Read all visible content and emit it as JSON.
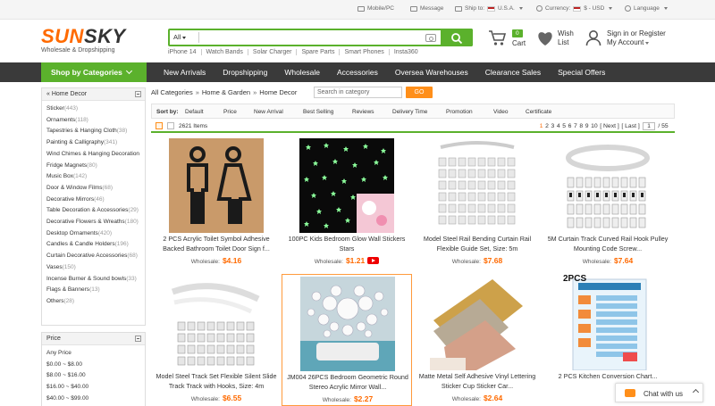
{
  "colors": {
    "brand_orange": "#ff6a00",
    "accent_green": "#5bb12c",
    "nav_dark": "#3a3a3a"
  },
  "topbar": {
    "mobile": "Mobile/PC",
    "message": "Message",
    "ship_to": "Ship to:",
    "ship_country": "U.S.A.",
    "currency": "Currency:",
    "currency_value": "$ - USD",
    "language": "Language"
  },
  "logo": {
    "brand_main": "SUN",
    "brand_tail": "SKY",
    "tagline": "Wholesale & Dropshipping"
  },
  "search": {
    "category": "All",
    "placeholder": "",
    "hotwords": [
      "iPhone 14",
      "Watch Bands",
      "Solar Charger",
      "Spare Parts",
      "Smart Phones",
      "Insta360"
    ]
  },
  "header": {
    "cart_count": "0",
    "cart_label": "Cart",
    "wish_label": "Wish List",
    "signin_label": "Sign in or Register",
    "account_label": "My Account"
  },
  "nav": {
    "shop_by": "Shop by Categories",
    "links": [
      "New Arrivals",
      "Dropshipping",
      "Wholesale",
      "Accessories",
      "Oversea Warehouses",
      "Clearance Sales",
      "Special Offers"
    ]
  },
  "sidebar": {
    "category_head": "« Home Decor",
    "categories": [
      {
        "name": "Sticker",
        "count": "(443)"
      },
      {
        "name": "Ornaments",
        "count": "(118)"
      },
      {
        "name": "Tapestries & Hanging Cloth",
        "count": "(38)"
      },
      {
        "name": "Painting & Calligraphy",
        "count": "(341)"
      },
      {
        "name": "Wind Chimes & Hanging Decoration",
        "count": ""
      },
      {
        "name": "Fridge Magnets",
        "count": "(80)"
      },
      {
        "name": "Music Box",
        "count": "(142)"
      },
      {
        "name": "Door & Window Films",
        "count": "(68)"
      },
      {
        "name": "Decorative Mirrors",
        "count": "(46)"
      },
      {
        "name": "Table Decoration & Accessories",
        "count": "(29)"
      },
      {
        "name": "Decorative Flowers & Wreaths",
        "count": "(180)"
      },
      {
        "name": "Desktop Ornaments",
        "count": "(420)"
      },
      {
        "name": "Candles & Candle Holders",
        "count": "(196)"
      },
      {
        "name": "Curtain Decorative Accessories",
        "count": "(68)"
      },
      {
        "name": "Vases",
        "count": "(150)"
      },
      {
        "name": "Incense Burner & Sound bowls",
        "count": "(33)"
      },
      {
        "name": "Flags & Banners",
        "count": "(13)"
      },
      {
        "name": "Others",
        "count": "(28)"
      }
    ],
    "price_head": "Price",
    "prices": [
      "Any Price",
      "$0.00 ~ $8.00",
      "$8.00 ~ $16.00",
      "$16.00 ~ $40.00",
      "$40.00 ~ $99.00"
    ]
  },
  "breadcrumb": {
    "items": [
      "All Categories",
      "Home & Garden",
      "Home Decor"
    ],
    "sep": "»",
    "search_placeholder": "Search in category",
    "go": "GO"
  },
  "sort": {
    "label": "Sort by:",
    "options": [
      "Default",
      "Price",
      "New Arrival",
      "Best Selling",
      "Reviews",
      "Delivery Time",
      "Promotion",
      "Video",
      "Certificate"
    ]
  },
  "results": {
    "count": "2621 Items",
    "pages": [
      "1",
      "2",
      "3",
      "4",
      "5",
      "6",
      "7",
      "8",
      "9",
      "10"
    ],
    "next": "[ Next ]",
    "last": "[ Last ]",
    "page_value": "1",
    "total": "/ 55"
  },
  "products": [
    {
      "title": "2 PCS Acrylic Toilet Symbol Adhesive Backed Bathroom Toilet Door Sign f...",
      "wholesale": "Wholesale:",
      "price": "$4.16",
      "video": false
    },
    {
      "title": "100PC Kids Bedroom Glow Wall Stickers Stars",
      "wholesale": "Wholesale:",
      "price": "$1.21",
      "video": true
    },
    {
      "title": "Model Steel Rail Bending Curtain Rail Flexible Guide Set, Size: 5m",
      "wholesale": "Wholesale:",
      "price": "$7.68",
      "video": false
    },
    {
      "title": "5M Curtain Track Curved Rail Hook Pulley Mounting Code Screw...",
      "wholesale": "Wholesale:",
      "price": "$7.64",
      "video": false
    },
    {
      "title": "Model Steel Track Set Flexible Silent Slide Track Track with Hooks, Size: 4m",
      "wholesale": "Wholesale:",
      "price": "$6.55",
      "video": false
    },
    {
      "title": "JM004 26PCS Bedroom Geometric Round Stereo Acrylic Mirror Wall...",
      "wholesale": "Wholesale:",
      "price": "$2.27",
      "video": false
    },
    {
      "title": "Matte Metal Self Adhesive Vinyl Lettering Sticker Cup Sticker Car...",
      "wholesale": "Wholesale:",
      "price": "$2.64",
      "video": false
    },
    {
      "title": "2 PCS Kitchen Conversion Chart...",
      "wholesale": "",
      "price": "",
      "video": false
    }
  ],
  "product_badge": "2PCS",
  "chat": {
    "label": "Chat with us"
  }
}
